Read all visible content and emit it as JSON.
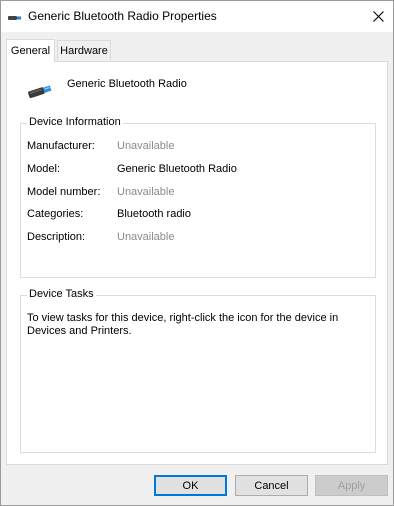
{
  "window": {
    "title": "Generic Bluetooth Radio Properties",
    "icon": "bluetooth-device-icon",
    "close_icon": "close-icon"
  },
  "tabs": [
    {
      "label": "General",
      "selected": true
    },
    {
      "label": "Hardware",
      "selected": false
    }
  ],
  "device": {
    "name": "Generic Bluetooth Radio",
    "icon": "usb-bluetooth-adapter-icon"
  },
  "device_info": {
    "legend": "Device Information",
    "rows": [
      {
        "label": "Manufacturer:",
        "value": "Unavailable"
      },
      {
        "label": "Model:",
        "value": "Generic Bluetooth Radio"
      },
      {
        "label": "Model number:",
        "value": "Unavailable"
      },
      {
        "label": "Categories:",
        "value": "Bluetooth radio"
      },
      {
        "label": "Description:",
        "value": "Unavailable"
      }
    ]
  },
  "device_tasks": {
    "legend": "Device Tasks",
    "text": "To view tasks for this device, right-click the icon for the device in Devices and Printers."
  },
  "buttons": {
    "ok": "OK",
    "cancel": "Cancel",
    "apply": "Apply"
  },
  "colors": {
    "accent": "#0078d7",
    "disabled_text": "#8a8a8a"
  }
}
